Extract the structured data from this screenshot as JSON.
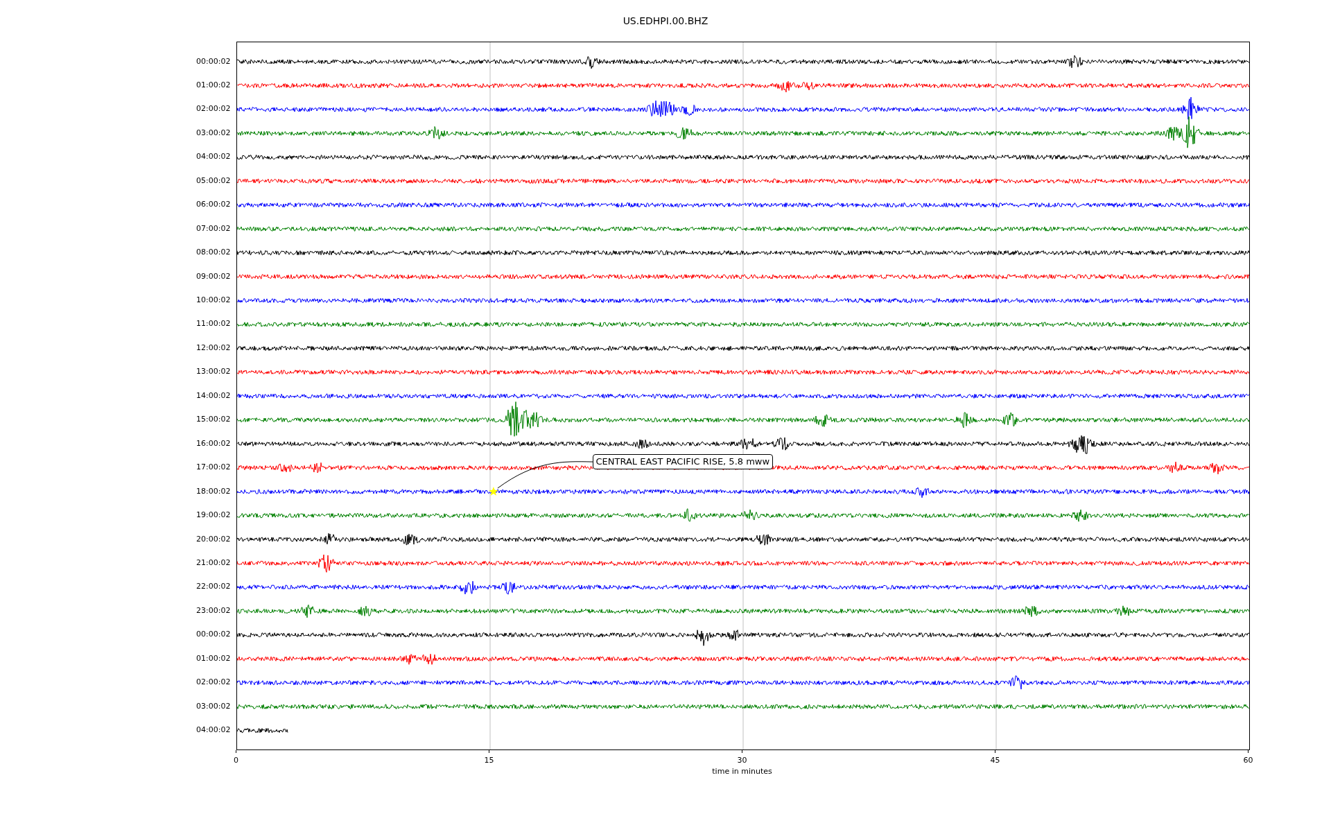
{
  "title": "US.EDHPI.00.BHZ",
  "rows": [
    {
      "label": "00:00:02",
      "color": "#000000",
      "kind": "full"
    },
    {
      "label": "01:00:02",
      "color": "#ff0000",
      "kind": "full"
    },
    {
      "label": "02:00:02",
      "color": "#0000ff",
      "kind": "full"
    },
    {
      "label": "03:00:02",
      "color": "#008000",
      "kind": "full"
    },
    {
      "label": "04:00:02",
      "color": "#000000",
      "kind": "full"
    },
    {
      "label": "05:00:02",
      "color": "#ff0000",
      "kind": "full"
    },
    {
      "label": "06:00:02",
      "color": "#0000ff",
      "kind": "full"
    },
    {
      "label": "07:00:02",
      "color": "#008000",
      "kind": "full"
    },
    {
      "label": "08:00:02",
      "color": "#000000",
      "kind": "full"
    },
    {
      "label": "09:00:02",
      "color": "#ff0000",
      "kind": "full"
    },
    {
      "label": "10:00:02",
      "color": "#0000ff",
      "kind": "full"
    },
    {
      "label": "11:00:02",
      "color": "#008000",
      "kind": "full"
    },
    {
      "label": "12:00:02",
      "color": "#000000",
      "kind": "full"
    },
    {
      "label": "13:00:02",
      "color": "#ff0000",
      "kind": "full"
    },
    {
      "label": "14:00:02",
      "color": "#0000ff",
      "kind": "full"
    },
    {
      "label": "15:00:02",
      "color": "#008000",
      "kind": "full"
    },
    {
      "label": "16:00:02",
      "color": "#000000",
      "kind": "full"
    },
    {
      "label": "17:00:02",
      "color": "#ff0000",
      "kind": "full"
    },
    {
      "label": "18:00:02",
      "color": "#0000ff",
      "kind": "full"
    },
    {
      "label": "19:00:02",
      "color": "#008000",
      "kind": "full"
    },
    {
      "label": "20:00:02",
      "color": "#000000",
      "kind": "full"
    },
    {
      "label": "21:00:02",
      "color": "#ff0000",
      "kind": "full"
    },
    {
      "label": "22:00:02",
      "color": "#0000ff",
      "kind": "full"
    },
    {
      "label": "23:00:02",
      "color": "#008000",
      "kind": "full"
    },
    {
      "label": "00:00:02",
      "color": "#000000",
      "kind": "full"
    },
    {
      "label": "01:00:02",
      "color": "#ff0000",
      "kind": "full"
    },
    {
      "label": "02:00:02",
      "color": "#0000ff",
      "kind": "full"
    },
    {
      "label": "03:00:02",
      "color": "#008000",
      "kind": "full"
    },
    {
      "label": "04:00:02",
      "color": "#000000",
      "kind": "partial"
    }
  ],
  "x_axis": {
    "ticks": [
      "0",
      "15",
      "30",
      "45",
      "60"
    ],
    "label": "time in minutes"
  },
  "annotation": {
    "text": "CENTRAL EAST PACIFIC RISE, 5.8 mww"
  }
}
